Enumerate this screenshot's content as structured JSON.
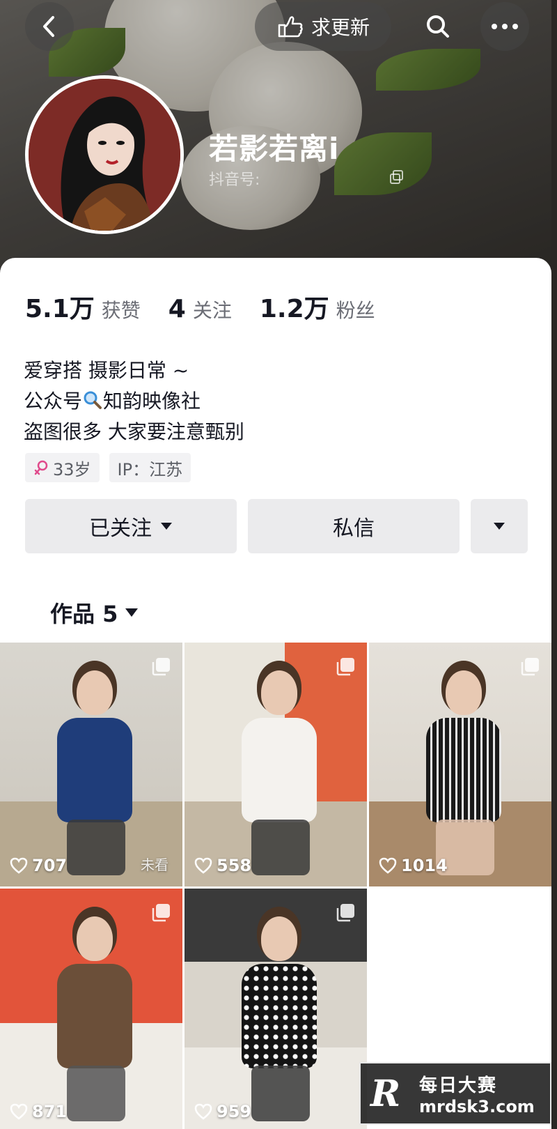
{
  "header": {
    "update_label": "求更新",
    "nickname": "若影若离i",
    "douyin_id_label": "抖音号:"
  },
  "stats": {
    "likes_value": "5.1万",
    "likes_label": "获赞",
    "following_value": "4",
    "following_label": "关注",
    "followers_value": "1.2万",
    "followers_label": "粉丝"
  },
  "bio": {
    "line1": "爱穿搭 摄影日常 ~",
    "line2_prefix": "公众号",
    "line2_suffix": "知韵映像社",
    "line3": "盗图很多 大家要注意甄别"
  },
  "tags": {
    "age": "33岁",
    "ip": "IP：江苏"
  },
  "actions": {
    "follow_label": "已关注",
    "message_label": "私信"
  },
  "works": {
    "tab_label": "作品 5"
  },
  "grid": [
    {
      "likes": "707",
      "status": "未看"
    },
    {
      "likes": "558"
    },
    {
      "likes": "1014"
    },
    {
      "likes": "871"
    },
    {
      "likes": "959"
    }
  ],
  "watermark": {
    "logo": "R",
    "name": "每日大赛",
    "url": "mrdsk3.com"
  },
  "icons": {
    "back": "chevron-left-icon",
    "update": "pointing-hand-icon",
    "search": "search-icon",
    "more": "more-dots-icon",
    "copy": "copy-icon",
    "gender": "female-icon",
    "caret": "caret-down-icon",
    "heart": "heart-icon",
    "multi": "multi-image-icon",
    "magnifier": "magnifier-icon"
  },
  "colors": {
    "accent_pink": "#e04b8c",
    "button_bg": "#ebebed",
    "text_primary": "#161823",
    "text_secondary": "#6b6d75"
  }
}
